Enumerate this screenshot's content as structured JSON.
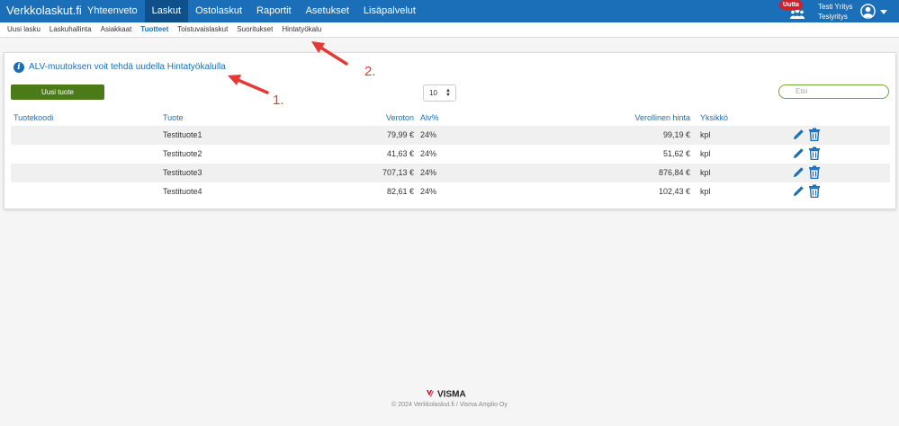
{
  "header": {
    "brand": "Verkkolaskut.fi",
    "nav": [
      "Yhteenveto",
      "Laskut",
      "Ostolaskut",
      "Raportit",
      "Asetukset",
      "Lisäpalvelut"
    ],
    "active_nav": "Laskut",
    "badge": "Uutta",
    "user_name": "Testi Yritys",
    "company": "Tesiyritys"
  },
  "subnav": {
    "items": [
      "Uusi lasku",
      "Laskuhallinta",
      "Asiakkaat",
      "Tuotteet",
      "Toistuvaislaskut",
      "Suoritukset",
      "Hintatyökalu"
    ],
    "active": "Tuotteet"
  },
  "main": {
    "info_text": "ALV-muutoksen voit tehdä uudella Hintatyökalulla",
    "new_product_label": "Uusi tuote",
    "page_size": "10",
    "search_placeholder": "Etsi",
    "columns": [
      "Tuotekoodi",
      "Tuote",
      "Veroton",
      "Alv%",
      "Verollinen hinta",
      "Yksikkö"
    ],
    "rows": [
      {
        "code": "",
        "product": "Testituote1",
        "net": "79,99 €",
        "vat": "24%",
        "gross": "99,19 €",
        "unit": "kpl"
      },
      {
        "code": "",
        "product": "Testituote2",
        "net": "41,63 €",
        "vat": "24%",
        "gross": "51,62 €",
        "unit": "kpl"
      },
      {
        "code": "",
        "product": "Testituote3",
        "net": "707,13 €",
        "vat": "24%",
        "gross": "876,84 €",
        "unit": "kpl"
      },
      {
        "code": "",
        "product": "Testituote4",
        "net": "82,61 €",
        "vat": "24%",
        "gross": "102,43 €",
        "unit": "kpl"
      }
    ]
  },
  "annotations": [
    "1.",
    "2."
  ],
  "footer": {
    "logo": "VISMA",
    "copyright": "© 2024 Verkkolaskut.fi / Visma Amplio Oy"
  },
  "colors": {
    "topbar": "#1b6fb8",
    "active_nav": "#0f4f8a",
    "button_green": "#4a7b17",
    "annotation_red": "#e53935",
    "badge_red": "#d21f2f"
  },
  "icons": {
    "info": "info-icon",
    "users": "users-icon",
    "avatar": "user-circle-icon",
    "edit": "pencil-icon",
    "delete": "trash-icon"
  }
}
